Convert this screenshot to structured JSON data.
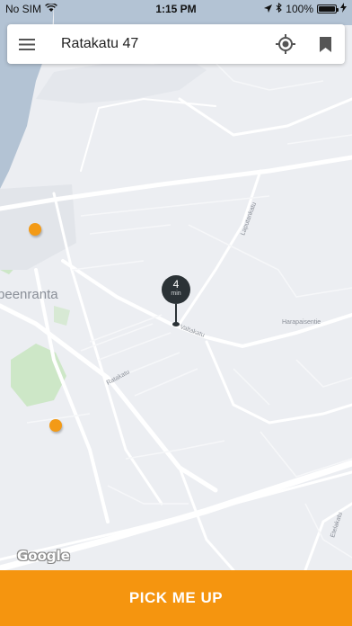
{
  "status_bar": {
    "carrier": "No SIM",
    "time": "1:15 PM",
    "battery_percent": "100%",
    "battery_level": 1.0
  },
  "search": {
    "address": "Ratakatu 47",
    "menu_icon": "hamburger-menu-icon",
    "locate_icon": "gps-target-icon",
    "saved_icon": "bookmark-icon"
  },
  "map": {
    "labels": {
      "city": "Lappeenranta",
      "street_1": "Ratakatu",
      "street_2": "Valtakatu",
      "street_3": "Harapaisentie",
      "street_4": "Laputankatu",
      "street_5": "Etelakatu"
    },
    "eta": {
      "value": "4",
      "unit": "min"
    },
    "attribution": "Google"
  },
  "action": {
    "pick_me_up": "PICK ME UP"
  },
  "colors": {
    "accent": "#f5950f",
    "map_background": "#eceef2",
    "water": "#a9bcd0",
    "park": "#c9e6c3",
    "pin": "#2b3236"
  }
}
